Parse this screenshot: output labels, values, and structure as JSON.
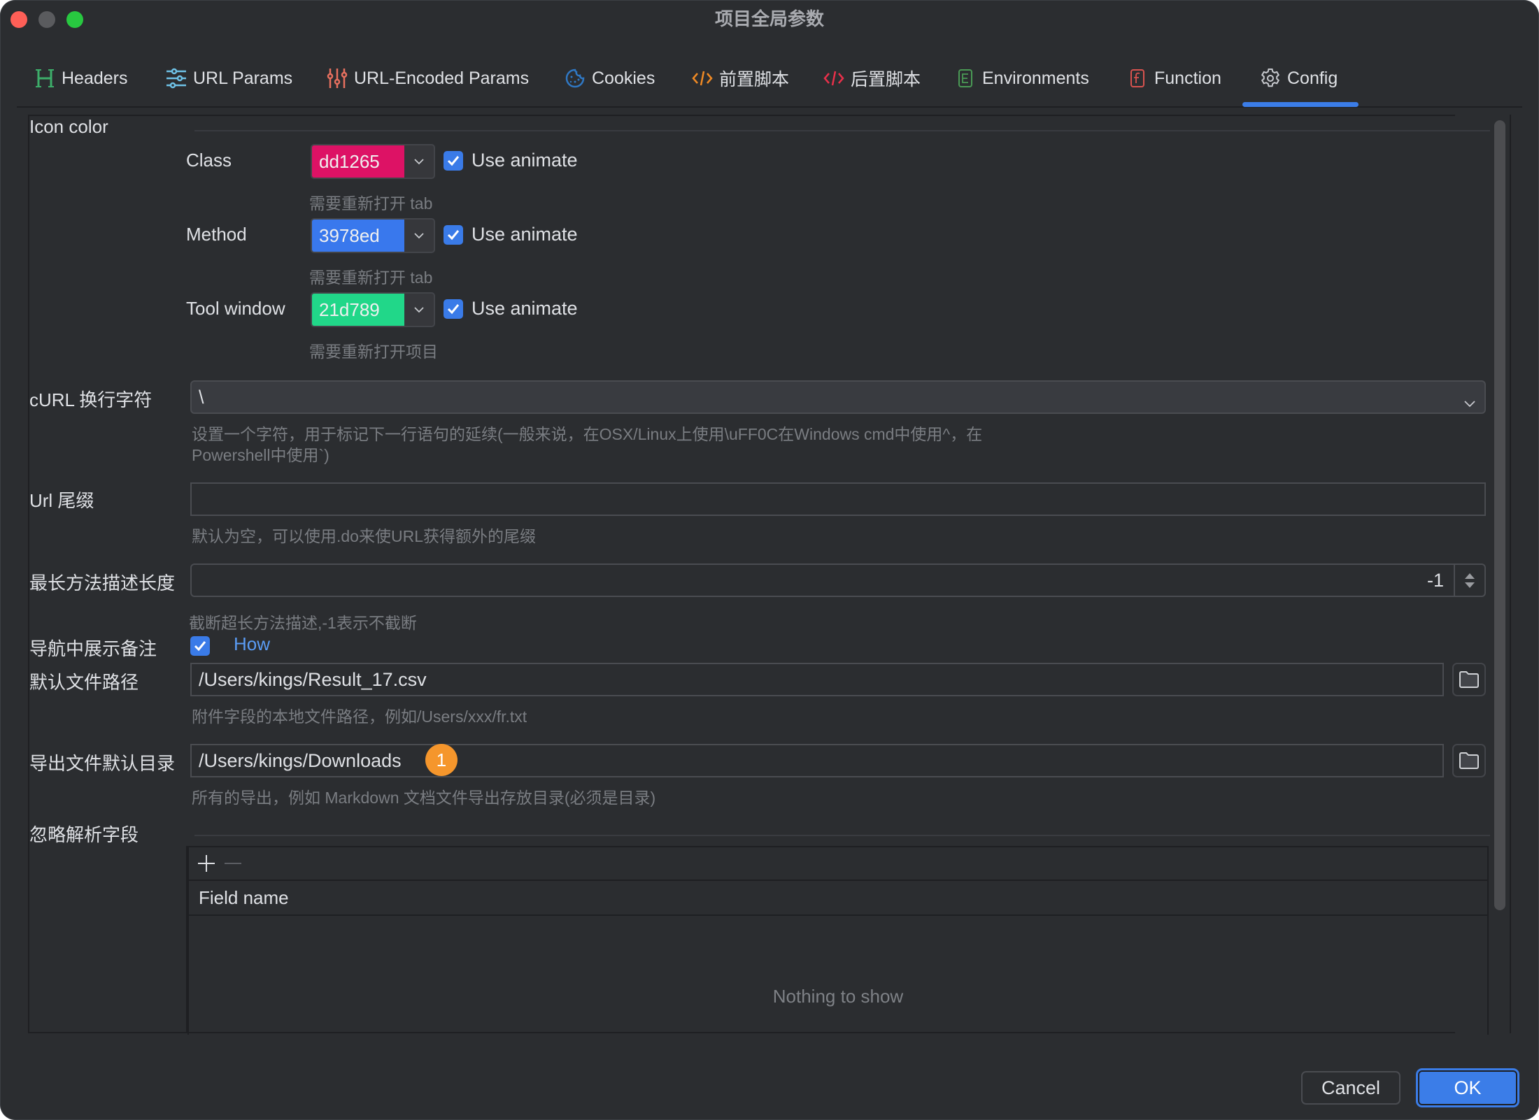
{
  "window": {
    "title": "项目全局参数"
  },
  "tabs": [
    {
      "label": "Headers",
      "icon": "headers-h-icon",
      "color": "#3dae6a"
    },
    {
      "label": "URL Params",
      "icon": "sliders-icon",
      "color": "#6fc3e8"
    },
    {
      "label": "URL-Encoded Params",
      "icon": "vertical-sliders-icon",
      "color": "#e8705f"
    },
    {
      "label": "Cookies",
      "icon": "cookie-icon",
      "color": "#2f78c4"
    },
    {
      "label": "前置脚本",
      "icon": "code-icon",
      "color": "#f08a24"
    },
    {
      "label": "后置脚本",
      "icon": "code-icon",
      "color": "#e8304a"
    },
    {
      "label": "Environments",
      "icon": "environment-e-icon",
      "color": "#4a9a55"
    },
    {
      "label": "Function",
      "icon": "function-f-icon",
      "color": "#d9534f"
    },
    {
      "label": "Config",
      "icon": "gear-icon",
      "color": "#c8cacf",
      "active": true
    }
  ],
  "icon_color": {
    "section_label": "Icon color",
    "rows": [
      {
        "label": "Class",
        "value": "dd1265",
        "color": "#dd1265",
        "animate_label": "Use animate",
        "animate_checked": true,
        "hint": "需要重新打开 tab"
      },
      {
        "label": "Method",
        "value": "3978ed",
        "color": "#3978ed",
        "animate_label": "Use animate",
        "animate_checked": true,
        "hint": "需要重新打开 tab"
      },
      {
        "label": "Tool window",
        "value": "21d789",
        "color": "#21d789",
        "animate_label": "Use animate",
        "animate_checked": true,
        "hint": "需要重新打开项目"
      }
    ]
  },
  "curl": {
    "label": "cURL 换行字符",
    "value": "\\",
    "hint_line1": "设置一个字符，用于标记下一行语句的延续(一般来说，在OSX/Linux上使用\\uFF0C在Windows cmd中使用^，在",
    "hint_line2": "Powershell中使用`)"
  },
  "url_suffix": {
    "label": "Url 尾缀",
    "value": "",
    "hint": "默认为空，可以使用.do来使URL获得额外的尾缀"
  },
  "max_desc_length": {
    "label": "最长方法描述长度",
    "value": "-1",
    "hint": "截断超长方法描述,-1表示不截断"
  },
  "nav_notes": {
    "label": "导航中展示备注",
    "checked": true,
    "link": "How"
  },
  "default_file_path": {
    "label": "默认文件路径",
    "value": "/Users/kings/Result_17.csv",
    "hint": "附件字段的本地文件路径，例如/Users/xxx/fr.txt"
  },
  "export_dir": {
    "label": "导出文件默认目录",
    "value": "/Users/kings/Downloads",
    "badge": "1",
    "hint": "所有的导出，例如 Markdown 文档文件导出存放目录(必须是目录)"
  },
  "ignore_fields": {
    "label": "忽略解析字段",
    "columns": [
      "Field name"
    ],
    "rows": [],
    "empty_text": "Nothing to show"
  },
  "footer": {
    "cancel": "Cancel",
    "ok": "OK"
  }
}
